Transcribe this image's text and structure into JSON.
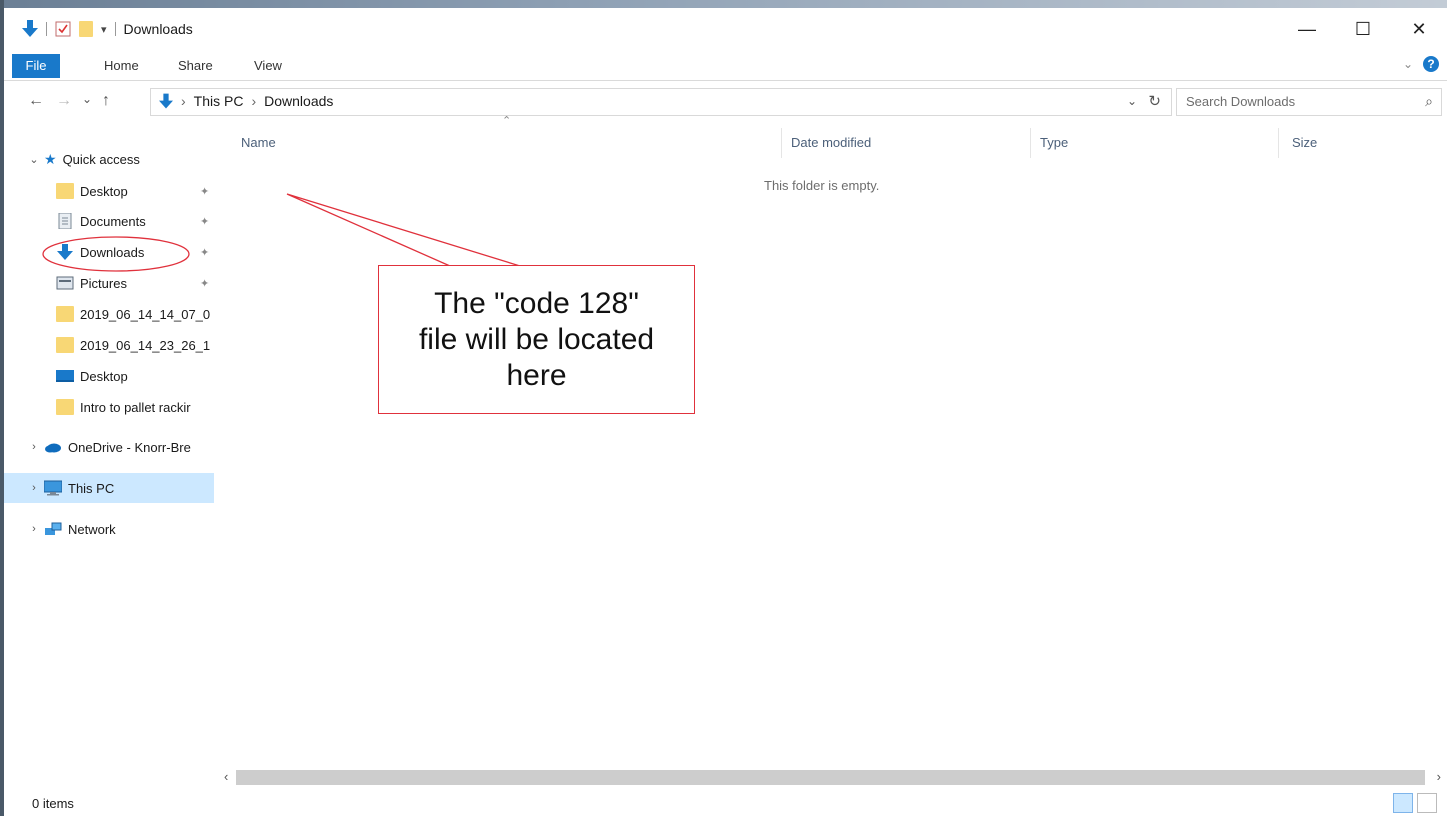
{
  "window": {
    "title": "Downloads",
    "controls": {
      "minimize": "—",
      "maximize": "☐",
      "close": "✕"
    }
  },
  "ribbon": {
    "tabs": [
      "File",
      "Home",
      "Share",
      "View"
    ],
    "expand": "⌄",
    "help": "?"
  },
  "nav_buttons": {
    "back": "←",
    "forward": "→",
    "recent": "⌄",
    "up": "↑"
  },
  "address": {
    "crumbs": [
      "This PC",
      "Downloads"
    ],
    "separator": "›",
    "refresh": "↻",
    "dropdown": "⌄"
  },
  "search": {
    "placeholder": "Search Downloads",
    "icon": "⌕"
  },
  "sidebar": {
    "quick_access": "Quick access",
    "items": [
      {
        "label": "Desktop",
        "icon": "folder-icon",
        "pinned": true
      },
      {
        "label": "Documents",
        "icon": "documents-icon",
        "pinned": true
      },
      {
        "label": "Downloads",
        "icon": "download-icon",
        "pinned": true
      },
      {
        "label": "Pictures",
        "icon": "pictures-icon",
        "pinned": true
      },
      {
        "label": "2019_06_14_14_07_0",
        "icon": "folder-icon",
        "pinned": false
      },
      {
        "label": "2019_06_14_23_26_1",
        "icon": "folder-icon",
        "pinned": false
      },
      {
        "label": "Desktop",
        "icon": "desktop-icon",
        "pinned": false
      },
      {
        "label": "Intro to pallet rackir",
        "icon": "folder-icon",
        "pinned": false
      }
    ],
    "onedrive": "OneDrive - Knorr-Bre",
    "this_pc": "This PC",
    "network": "Network"
  },
  "columns": [
    "Name",
    "Date modified",
    "Type",
    "Size"
  ],
  "empty_message": "This folder is empty.",
  "status": {
    "items": "0 items"
  },
  "callout": {
    "lines": [
      "The \"code 128\"",
      "file will be located",
      "here"
    ]
  },
  "colors": {
    "accent": "#1979ca",
    "selection": "#cce8ff",
    "annotation": "#e0313c",
    "folder": "#f8d775"
  }
}
